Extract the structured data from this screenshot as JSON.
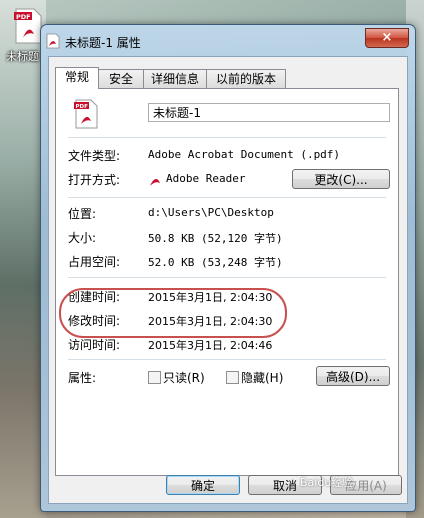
{
  "desktop": {
    "icon_label": "未标题",
    "icon_badge": "PDF"
  },
  "window": {
    "title": "未标题-1 属性",
    "close_glyph": "×"
  },
  "tabs": [
    {
      "label": "常规",
      "active": true
    },
    {
      "label": "安全",
      "active": false
    },
    {
      "label": "详细信息",
      "active": false
    },
    {
      "label": "以前的版本",
      "active": false
    }
  ],
  "general": {
    "file_name": "未标题-1",
    "file_type_label": "文件类型:",
    "file_type_value": "Adobe Acrobat Document (.pdf)",
    "open_with_label": "打开方式:",
    "open_with_value": "Adobe Reader",
    "change_button": "更改(C)...",
    "location_label": "位置:",
    "location_value": "d:\\Users\\PC\\Desktop",
    "size_label": "大小:",
    "size_value": "50.8 KB (52,120 字节)",
    "size_on_disk_label": "占用空间:",
    "size_on_disk_value": "52.0 KB (53,248 字节)",
    "created_label": "创建时间:",
    "created_value": "2015年3月1日, 2:04:30",
    "modified_label": "修改时间:",
    "modified_value": "2015年3月1日, 2:04:30",
    "accessed_label": "访问时间:",
    "accessed_value": "2015年3月1日, 2:04:46",
    "attributes_label": "属性:",
    "readonly_label": "只读(R)",
    "hidden_label": "隐藏(H)",
    "advanced_button": "高级(D)..."
  },
  "footer": {
    "ok": "确定",
    "cancel": "取消",
    "apply": "应用(A)"
  },
  "watermark": "Baidu经验",
  "colors": {
    "pdf_red": "#c8102e",
    "highlight_ring": "#c8504e",
    "close_red": "#c8412b"
  }
}
